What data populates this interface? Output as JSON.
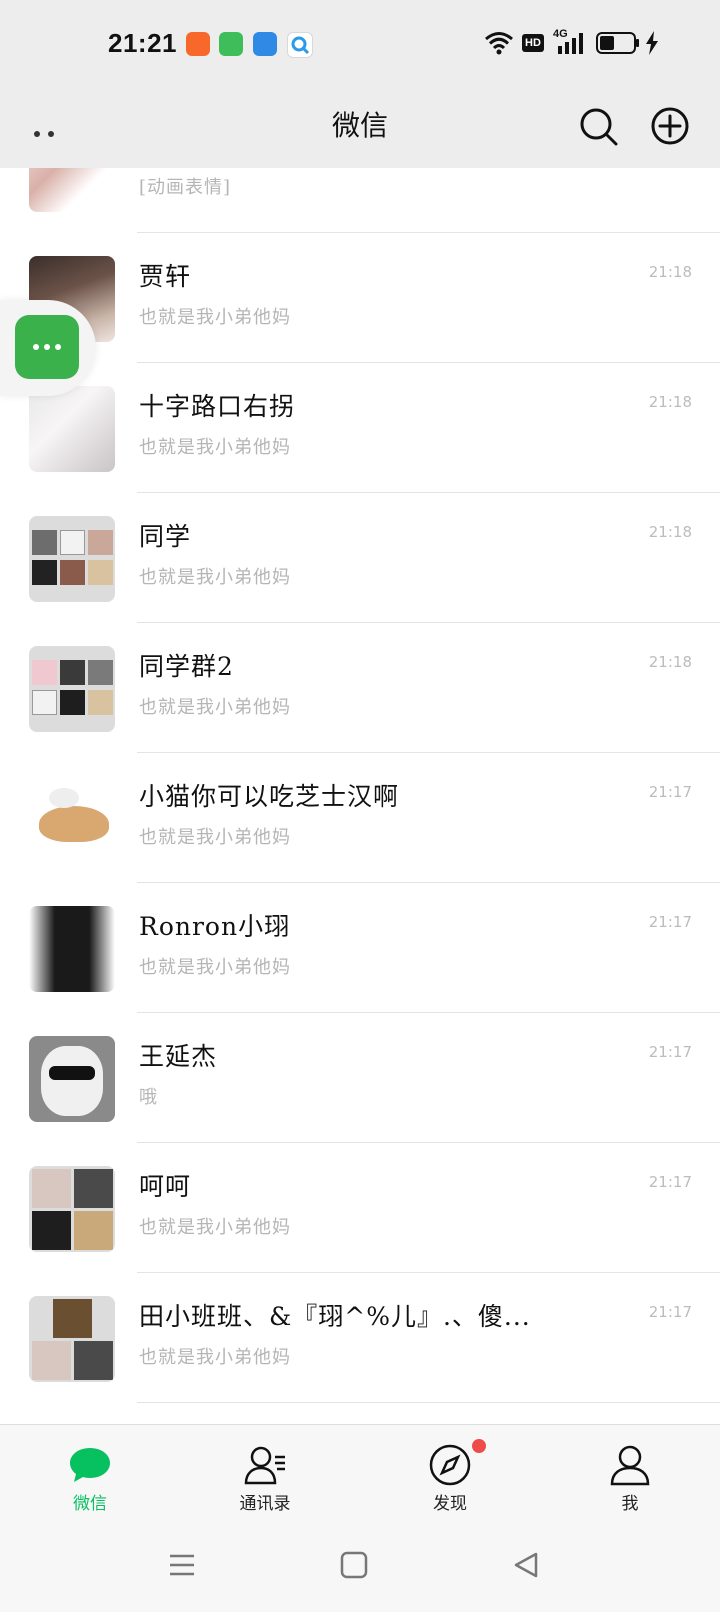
{
  "status_bar": {
    "time": "21:21",
    "app_icons": [
      {
        "name": "video-app-icon",
        "color": "#f7682a"
      },
      {
        "name": "market-app-icon",
        "color": "#3ebd5b"
      },
      {
        "name": "notes-app-icon",
        "color": "#2f8ae5"
      },
      {
        "name": "browser-app-icon",
        "color": "#2b9ae8"
      }
    ],
    "network_badge": "HD",
    "network_type": "4G"
  },
  "header": {
    "title": "微信"
  },
  "chats": [
    {
      "name": "",
      "preview": "[动画表情]",
      "time": ""
    },
    {
      "name": "贾轩",
      "preview": "也就是我小弟他妈",
      "time": "21:18"
    },
    {
      "name": "十字路口右拐",
      "preview": "也就是我小弟他妈",
      "time": "21:18"
    },
    {
      "name": "同学",
      "preview": "也就是我小弟他妈",
      "time": "21:18"
    },
    {
      "name": "同学群2",
      "preview": "也就是我小弟他妈",
      "time": "21:18"
    },
    {
      "name": "小猫你可以吃芝士汉啊",
      "preview": "也就是我小弟他妈",
      "time": "21:17"
    },
    {
      "name": "Ronron小珝",
      "preview": "也就是我小弟他妈",
      "time": "21:17"
    },
    {
      "name": "王延杰",
      "preview": "哦",
      "time": "21:17"
    },
    {
      "name": "呵呵",
      "preview": "也就是我小弟他妈",
      "time": "21:17"
    },
    {
      "name": "田小班班、&『珝^%儿』.、傻...",
      "preview": "也就是我小弟他妈",
      "time": "21:17"
    }
  ],
  "tabs": [
    {
      "label": "微信",
      "icon": "chat-bubble-icon",
      "active": true
    },
    {
      "label": "通讯录",
      "icon": "contacts-icon",
      "active": false
    },
    {
      "label": "发现",
      "icon": "compass-icon",
      "active": false
    },
    {
      "label": "我",
      "icon": "person-icon",
      "active": false
    }
  ],
  "colors": {
    "accent": "#07c160",
    "header_bg": "#ededed",
    "badge": "#f04b4b",
    "float_button": "#3bb14c"
  }
}
